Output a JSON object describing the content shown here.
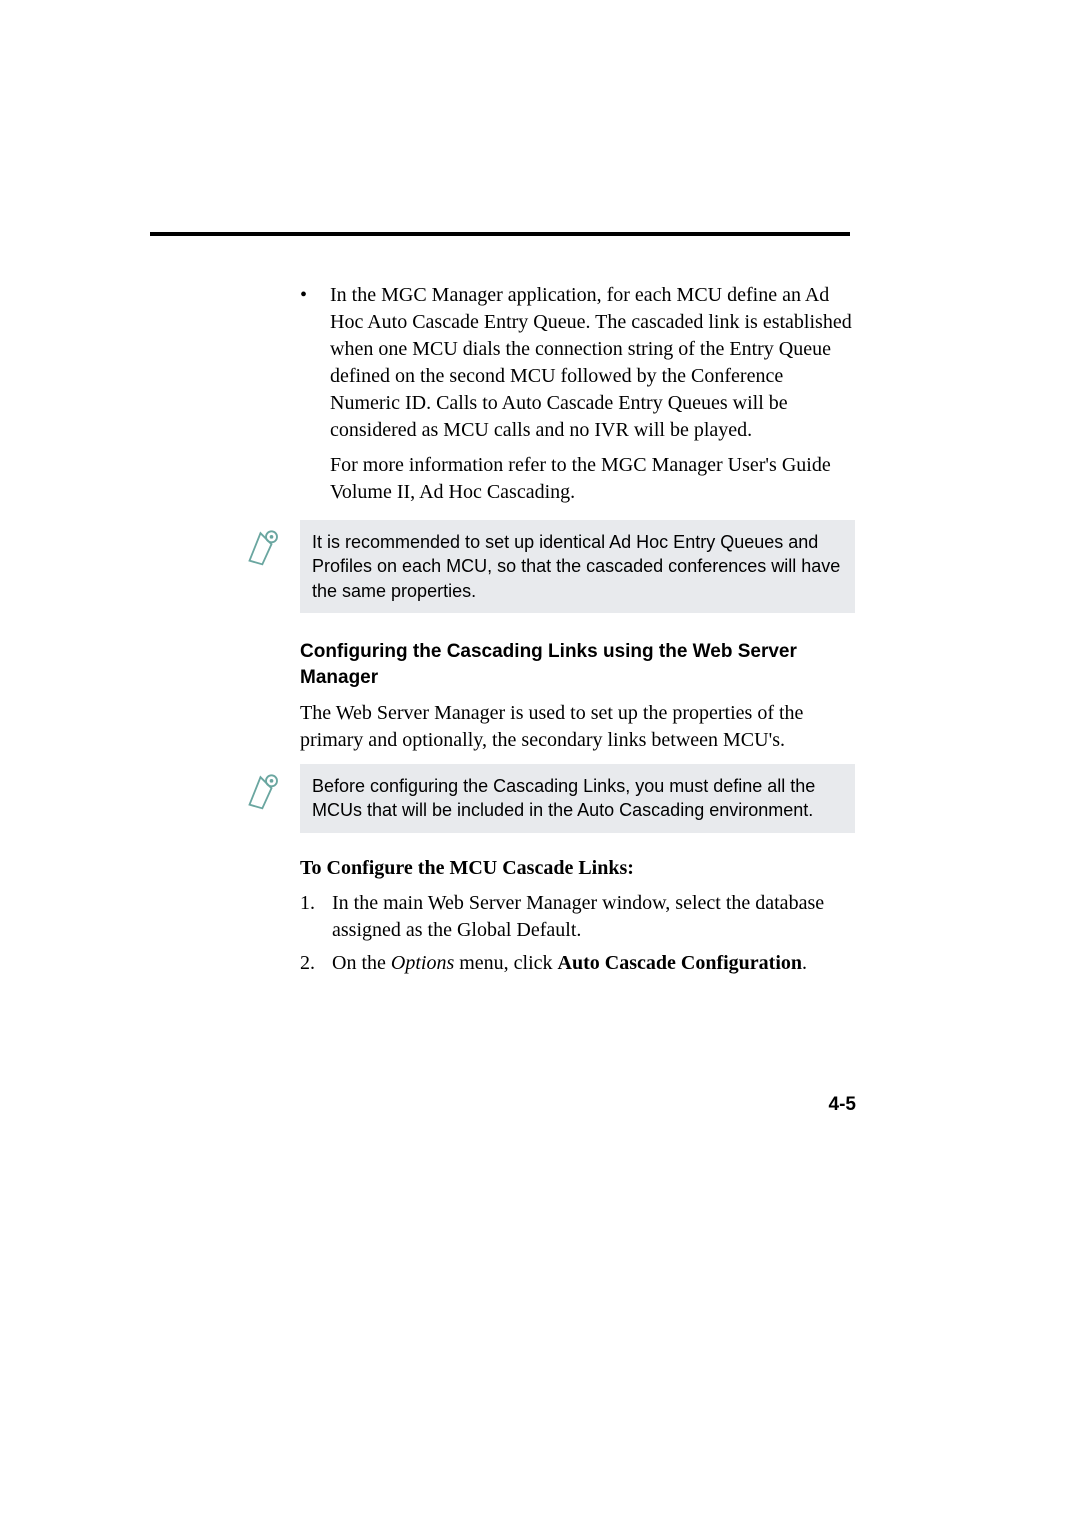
{
  "bullet1": {
    "text": "In the MGC Manager application, for each MCU define an Ad Hoc Auto Cascade Entry Queue. The cascaded link is established when one MCU dials the connection string of the Entry Queue defined on the second MCU followed by the Conference Numeric ID. Calls to Auto Cascade Entry Queues will be considered as MCU calls and no IVR will be played.",
    "sub": " For more information refer to the MGC Manager User's Guide Volume II, Ad Hoc Cascading."
  },
  "note1": "It is recommended to set up identical Ad Hoc Entry Queues and Profiles on each MCU, so that the cascaded conferences will have the same properties.",
  "section_heading": "Configuring the Cascading Links using the Web Server Manager",
  "section_para": "The Web Server Manager is used to set up the properties of the primary and optionally, the secondary links between MCU's.",
  "note2": "Before configuring the Cascading Links, you must define all the MCUs that will be included in the Auto Cascading environment.",
  "procedure_heading": "To Configure the MCU Cascade Links:",
  "steps": {
    "s1": {
      "num": "1.",
      "text": "In the main Web Server Manager window, select the database assigned as the Global Default."
    },
    "s2": {
      "num": "2.",
      "prefix": "On the ",
      "italic": "Options",
      "mid": " menu, click ",
      "bold": "Auto Cascade Configuration",
      "suffix": "."
    }
  },
  "page_number": "4-5"
}
